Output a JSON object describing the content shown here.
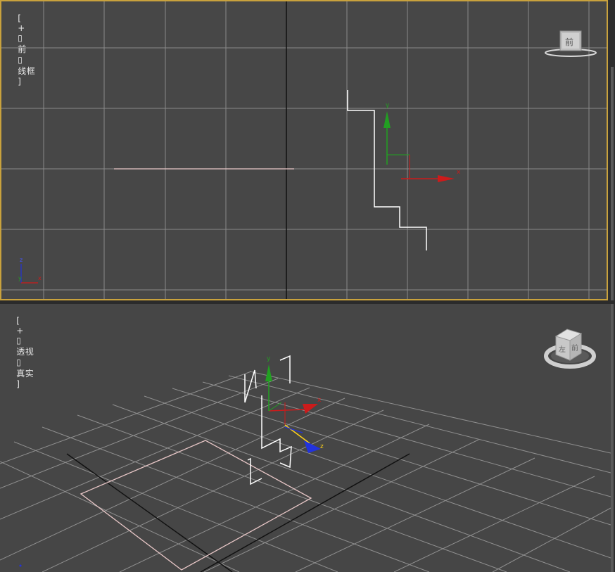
{
  "viewports": {
    "front": {
      "label": {
        "bracket_open": "[",
        "plus": "+",
        "sep1": "▯",
        "view_name": "前",
        "sep2": "▯",
        "shading": "线框",
        "bracket_close": "]"
      },
      "viewcube_face": "前",
      "gizmo_axes": {
        "y": "y",
        "x": "x"
      },
      "corner_axes": {
        "z": "z",
        "x": "x",
        "y": "y"
      }
    },
    "perspective": {
      "label": {
        "bracket_open": "[",
        "plus": "+",
        "sep1": "▯",
        "view_name": "透视",
        "sep2": "▯",
        "shading": "真实",
        "bracket_close": "]"
      },
      "viewcube_faces": {
        "front": "前",
        "left": "左"
      },
      "gizmo_axes": {
        "y": "y",
        "x": "x",
        "z": "z"
      }
    }
  },
  "colors": {
    "active_border": "#c9a23d",
    "axis_x": "#cc1b1b",
    "axis_y": "#22a022",
    "axis_z": "#2233dd",
    "spline": "#ffffff",
    "plane": "#e8c7c7",
    "grid": "#8a8a8a"
  }
}
